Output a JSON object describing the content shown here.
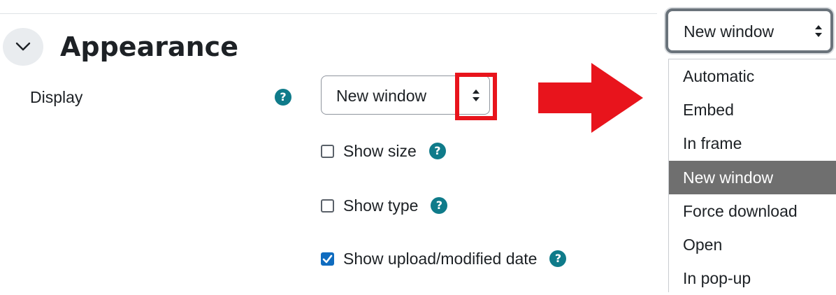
{
  "section": {
    "title": "Appearance"
  },
  "display": {
    "label": "Display",
    "help_icon": "question-mark",
    "select_value": "New window"
  },
  "checkboxes": [
    {
      "label": "Show size",
      "checked": false
    },
    {
      "label": "Show type",
      "checked": false
    },
    {
      "label": "Show upload/modified date",
      "checked": true
    }
  ],
  "dropdown": {
    "selected": "New window",
    "options": [
      "Automatic",
      "Embed",
      "In frame",
      "New window",
      "Force download",
      "Open",
      "In pop-up"
    ]
  },
  "colors": {
    "highlight": "#e8141c",
    "help_icon": "#0f7b8a",
    "checkbox_checked": "#0f6cbf",
    "option_selected_bg": "#6f6f6f"
  }
}
